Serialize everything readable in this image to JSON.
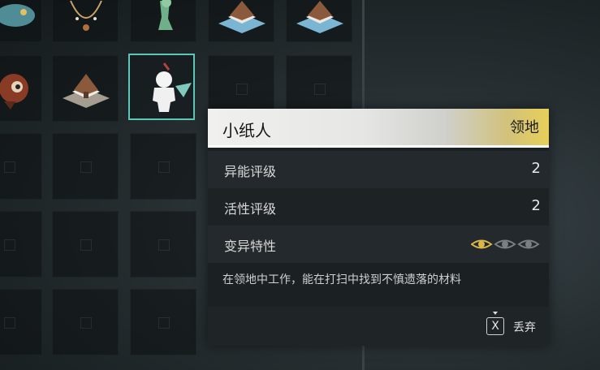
{
  "inventory": {
    "items": [
      {
        "icon": "fish-creature-icon"
      },
      {
        "icon": "necklace-icon"
      },
      {
        "icon": "green-dragon-figure-icon"
      },
      {
        "icon": "cottage-diorama-icon"
      },
      {
        "icon": "cottage-diorama-icon"
      },
      {
        "icon": "red-creature-icon"
      },
      {
        "icon": "cottage-diorama-icon"
      },
      {
        "icon": "paper-doll-icon"
      }
    ]
  },
  "item_detail": {
    "name": "小纸人",
    "tag": "领地",
    "stats": [
      {
        "label": "异能评级",
        "value": "2"
      },
      {
        "label": "活性评级",
        "value": "2"
      }
    ],
    "mutation": {
      "label": "变异特性",
      "icons": [
        "eye-icon-active",
        "eye-icon-inactive",
        "eye-icon-inactive"
      ],
      "active_color": "#d9b84a",
      "inactive_color": "#7a7f82"
    },
    "description": "在领地中工作，能在打扫中找到不慎遗落的材料",
    "actions": {
      "key": "X",
      "discard_label": "丢弃"
    }
  }
}
